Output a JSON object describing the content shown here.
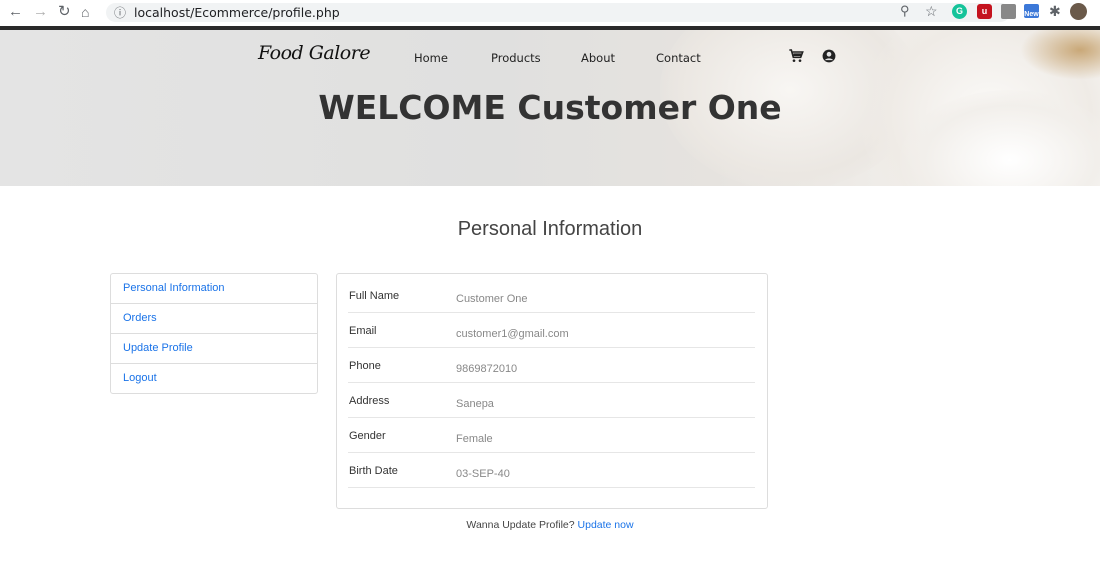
{
  "browser": {
    "url": "localhost/Ecommerce/profile.php",
    "extension_badge": "New"
  },
  "site": {
    "logo": "Food Galore",
    "nav": [
      "Home",
      "Products",
      "About",
      "Contact"
    ],
    "welcome": "WELCOME Customer One"
  },
  "page": {
    "section_title": "Personal Information",
    "sidebar": [
      {
        "label": "Personal Information"
      },
      {
        "label": "Orders"
      },
      {
        "label": "Update Profile"
      },
      {
        "label": "Logout"
      }
    ],
    "fields": [
      {
        "label": "Full Name",
        "value": "Customer One"
      },
      {
        "label": "Email",
        "value": "customer1@gmail.com"
      },
      {
        "label": "Phone",
        "value": "9869872010"
      },
      {
        "label": "Address",
        "value": "Sanepa"
      },
      {
        "label": "Gender",
        "value": "Female"
      },
      {
        "label": "Birth Date",
        "value": "03-SEP-40"
      }
    ],
    "footer_text": "Wanna Update Profile?",
    "footer_link": "Update now"
  },
  "colors": {
    "link": "#1a73e8",
    "heading": "#333333"
  }
}
